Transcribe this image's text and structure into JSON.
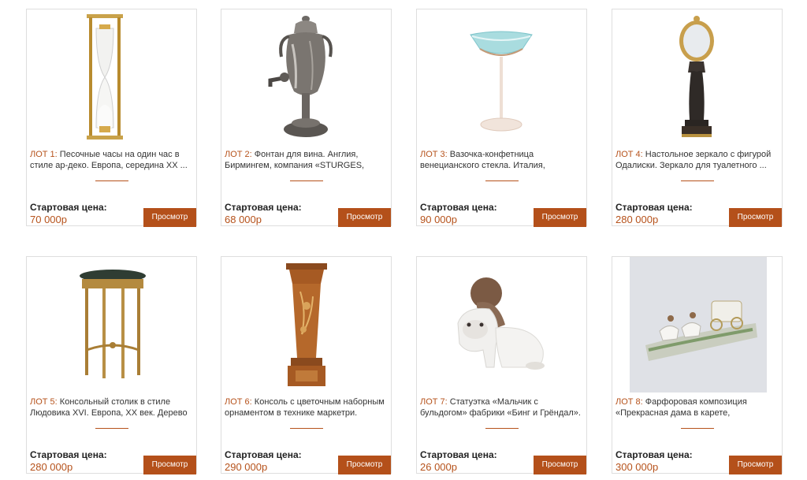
{
  "lots": [
    {
      "lot": "ЛОТ 1:",
      "title": " Песочные часы на один час в стиле ар-деко. Европа, середина XX ...",
      "price_label": "Стартовая цена:",
      "price": "70 000р",
      "button": "Просмотр"
    },
    {
      "lot": "ЛОТ 2:",
      "title": " Фонтан для вина. Англия, Бирмингем, компания «STURGES,",
      "price_label": "Стартовая цена:",
      "price": "68 000р",
      "button": "Просмотр"
    },
    {
      "lot": "ЛОТ 3:",
      "title": " Вазочка-конфетница венецианского стекла. Италия,",
      "price_label": "Стартовая цена:",
      "price": "90 000р",
      "button": "Просмотр"
    },
    {
      "lot": "ЛОТ 4:",
      "title": " Настольное зеркало с фигурой Одалиски. Зеркало для туалетного ...",
      "price_label": "Стартовая цена:",
      "price": "280 000р",
      "button": "Просмотр"
    },
    {
      "lot": "ЛОТ 5:",
      "title": " Консольный столик в стиле Людовика XVI. Европа, XX век. Дерево",
      "price_label": "Стартовая цена:",
      "price": "280 000р",
      "button": "Просмотр"
    },
    {
      "lot": "ЛОТ 6:",
      "title": " Консоль с цветочным наборным орнаментом в технике маркетри.",
      "price_label": "Стартовая цена:",
      "price": "290 000р",
      "button": "Просмотр"
    },
    {
      "lot": "ЛОТ 7:",
      "title": " Статуэтка «Мальчик с бульдогом» фабрики «Бинг и Грёндал».",
      "price_label": "Стартовая цена:",
      "price": "26 000р",
      "button": "Просмотр"
    },
    {
      "lot": "ЛОТ 8:",
      "title": " Фарфоровая композиция «Прекрасная дама в карете,",
      "price_label": "Стартовая цена:",
      "price": "300 000р",
      "button": "Просмотр"
    }
  ],
  "colors": {
    "accent": "#b6521b",
    "button": "#b4501a",
    "border": "#dedede"
  },
  "images": [
    "hourglass-image",
    "wine-fountain-image",
    "glass-vase-image",
    "mirror-statue-image",
    "console-table-image",
    "marquetry-pedestal-image",
    "boy-bulldog-figurine-image",
    "porcelain-carriage-image"
  ]
}
